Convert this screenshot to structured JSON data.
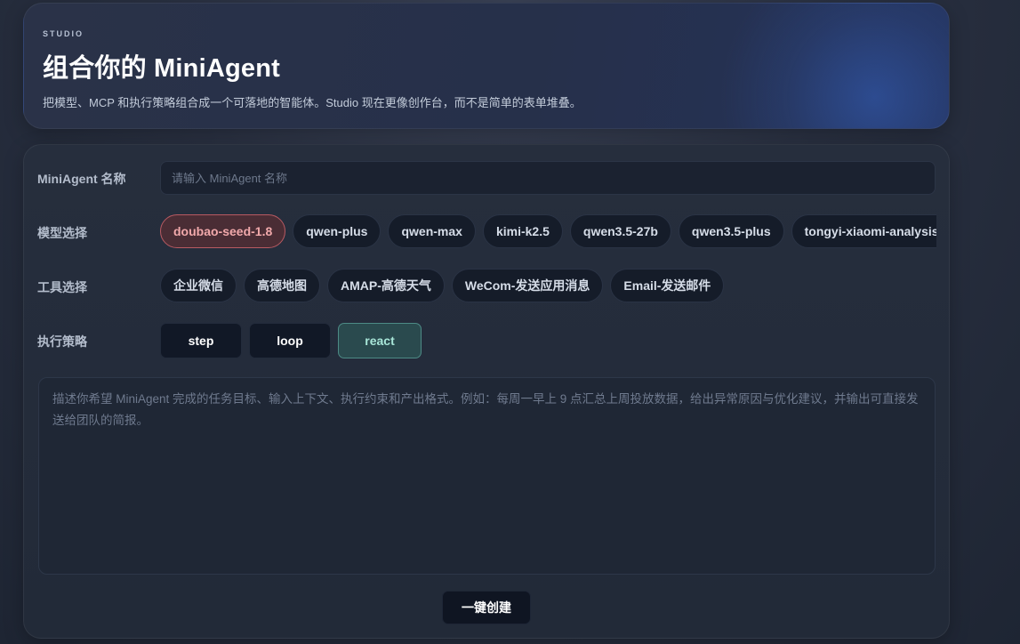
{
  "header": {
    "eyebrow": "STUDIO",
    "title": "组合你的 MiniAgent",
    "subtitle": "把模型、MCP 和执行策略组合成一个可落地的智能体。Studio 现在更像创作台，而不是简单的表单堆叠。"
  },
  "form": {
    "name_label": "MiniAgent 名称",
    "name_placeholder": "请输入 MiniAgent 名称",
    "name_value": "",
    "model_label": "模型选择",
    "models": [
      {
        "label": "doubao-seed-1.8",
        "selected": true
      },
      {
        "label": "qwen-plus",
        "selected": false
      },
      {
        "label": "qwen-max",
        "selected": false
      },
      {
        "label": "kimi-k2.5",
        "selected": false
      },
      {
        "label": "qwen3.5-27b",
        "selected": false
      },
      {
        "label": "qwen3.5-plus",
        "selected": false
      },
      {
        "label": "tongyi-xiaomi-analysis",
        "selected": false
      }
    ],
    "tool_label": "工具选择",
    "tools": [
      {
        "label": "企业微信",
        "selected": false
      },
      {
        "label": "高德地图",
        "selected": false
      },
      {
        "label": "AMAP-高德天气",
        "selected": false
      },
      {
        "label": "WeCom-发送应用消息",
        "selected": false
      },
      {
        "label": "Email-发送邮件",
        "selected": false
      }
    ],
    "strategy_label": "执行策略",
    "strategies": [
      {
        "label": "step",
        "selected": false
      },
      {
        "label": "loop",
        "selected": false
      },
      {
        "label": "react",
        "selected": true
      }
    ],
    "task_placeholder": "描述你希望 MiniAgent 完成的任务目标、输入上下文、执行约束和产出格式。例如：每周一早上 9 点汇总上周投放数据，给出异常原因与优化建议，并输出可直接发送给团队的简报。",
    "create_label": "一键创建"
  },
  "colors": {
    "selected_model_bg": "#4a2d35",
    "selected_model_text": "#f1a9ab",
    "selected_strategy_bg": "#2a4a4e",
    "selected_strategy_text": "#a8e6d8"
  }
}
